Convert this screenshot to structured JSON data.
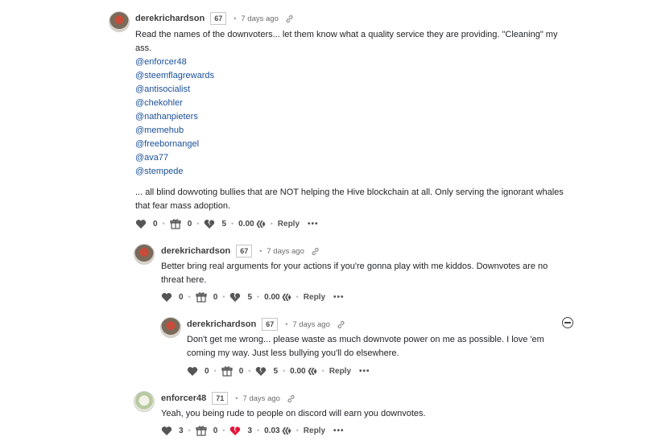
{
  "comments": [
    {
      "author": "derekrichardson",
      "reputation": "67",
      "time": "7 days ago",
      "text_lines": [
        "Read the names of the downvoters... let them know what a quality service they are providing. \"Cleaning\" my",
        "ass."
      ],
      "mentions": [
        "@enforcer48",
        "@steemflagrewards",
        "@antisocialist",
        "@chekohler",
        "@nathanpieters",
        "@memehub",
        "@freebornangel",
        "@ava77",
        "@stempede"
      ],
      "tail_lines": [
        "... all blind dowvoting bullies that are NOT helping the Hive blockchain at all. Only serving the ignorant whales",
        "that fear mass adoption."
      ],
      "upvotes": "0",
      "gifts": "0",
      "downvotes": "5",
      "payout": "0.00",
      "reply_label": "Reply",
      "more": "•••"
    },
    {
      "author": "derekrichardson",
      "reputation": "67",
      "time": "7 days ago",
      "text_lines": [
        "Better bring real arguments for your actions if you're gonna play with me kiddos. Downvotes are no",
        "threat here."
      ],
      "upvotes": "0",
      "gifts": "0",
      "downvotes": "5",
      "payout": "0.00",
      "reply_label": "Reply",
      "more": "•••"
    },
    {
      "author": "derekrichardson",
      "reputation": "67",
      "time": "7 days ago",
      "text_lines": [
        "Don't get me wrong... please waste as much downvote power on me as possible. I love 'em",
        "coming my way. Just less bullying you'll do elsewhere."
      ],
      "upvotes": "0",
      "gifts": "0",
      "downvotes": "5",
      "payout": "0.00",
      "reply_label": "Reply",
      "more": "•••"
    },
    {
      "author": "enforcer48",
      "reputation": "71",
      "time": "7 days ago",
      "text_lines": [
        "Yeah, you being rude to people on discord will earn you downvotes."
      ],
      "upvotes": "3",
      "gifts": "0",
      "downvotes": "3",
      "payout": "0.03",
      "reply_label": "Reply",
      "more": "•••"
    }
  ],
  "icons": {
    "heart": "heart-icon",
    "gift": "gift-icon",
    "broken_heart": "broken-heart-icon",
    "hive": "hive-icon",
    "link": "link-icon",
    "collapse": "collapse-icon"
  },
  "colors": {
    "mention": "#1a5099",
    "broken_heart_active": "#e31337"
  }
}
